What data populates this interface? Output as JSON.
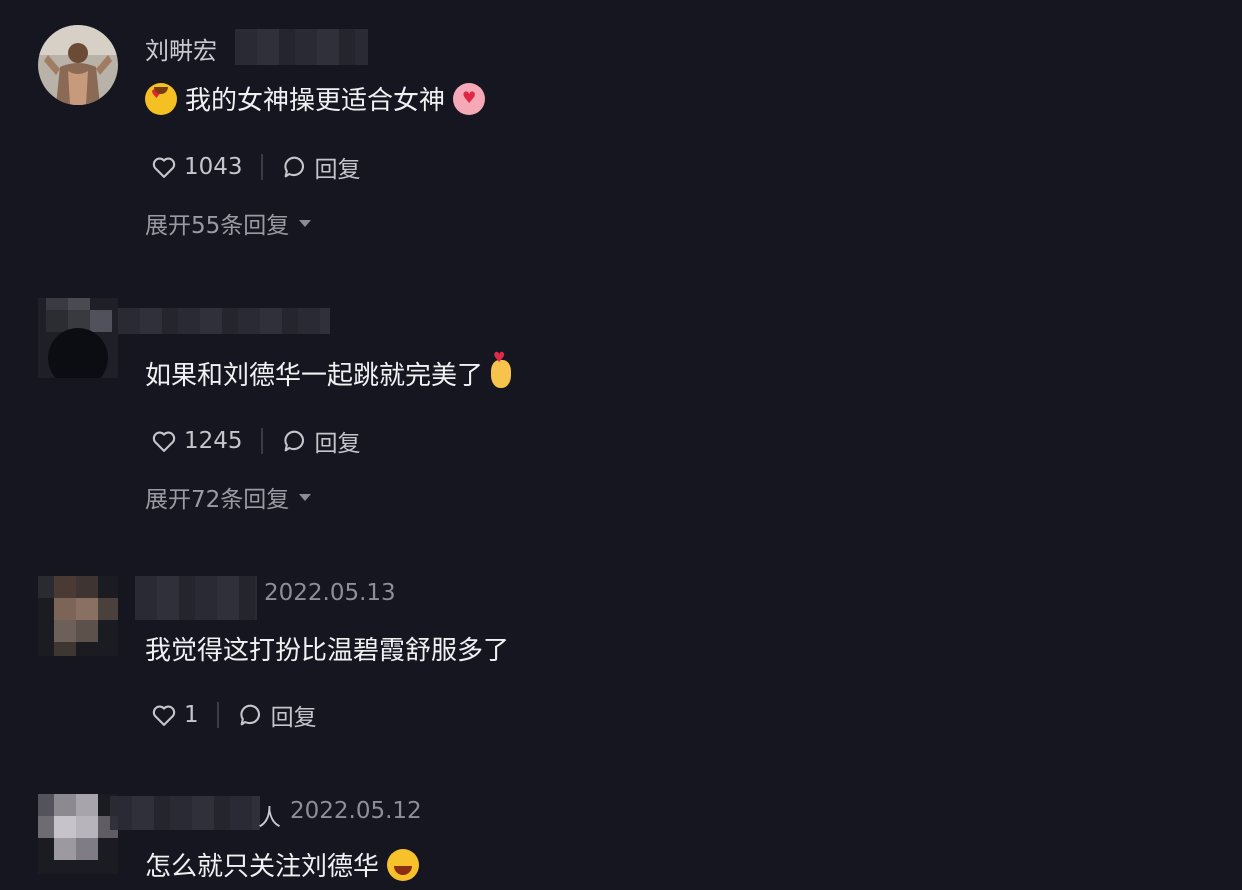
{
  "comments": [
    {
      "username": "刘畊宏",
      "text": "我的女神操更适合女神",
      "likes": "1043",
      "reply_label": "回复",
      "expand_label": "展开55条回复"
    },
    {
      "username": "",
      "text": "如果和刘德华一起跳就完美了",
      "likes": "1245",
      "reply_label": "回复",
      "expand_label": "展开72条回复"
    },
    {
      "username": "",
      "date": "2022.05.13",
      "text": "我觉得这打扮比温碧霞舒服多了",
      "likes": "1",
      "reply_label": "回复"
    },
    {
      "username": "人",
      "date": "2022.05.12",
      "text": "怎么就只关注刘德华"
    }
  ],
  "icons": [
    "heart-icon",
    "bubble-icon",
    "caret-down-icon",
    "heart-eyes-emoji",
    "hug-emoji",
    "finger-heart-emoji",
    "laughing-emoji"
  ],
  "colors": {
    "background": "#15161f",
    "text": "#f1f1f4",
    "muted": "#9a9ba2"
  }
}
